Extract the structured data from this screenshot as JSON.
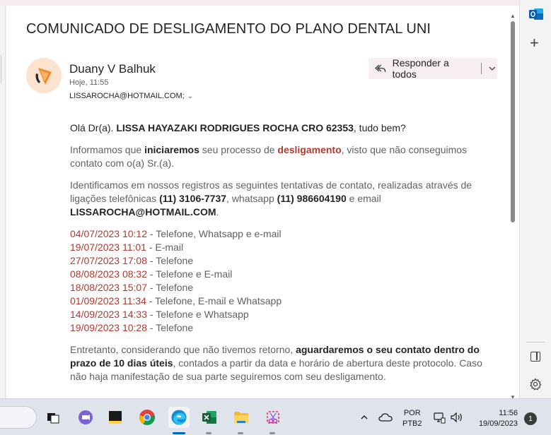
{
  "email": {
    "subject": "COMUNICADO DE DESLIGAMENTO DO PLANO DENTAL UNI",
    "sender_name": "Duany V Balhuk",
    "time": "Hoje, 11:55",
    "to": "LISSAROCHA@HOTMAIL.COM;",
    "reply_all_label": "Responder a todos",
    "greeting_prefix": "Olá Dr(a). ",
    "greeting_name": "LISSA HAYAZAKI RODRIGUES ROCHA CRO 62353",
    "greeting_suffix": ", tudo bem?",
    "p1_a": "Informamos que ",
    "p1_b": "iniciaremos",
    "p1_c": " seu processo de ",
    "p1_d": "desligamento",
    "p1_e": ", visto que não conseguimos contato com o(a) Sr.(a).",
    "p2_a": "Identificamos em nossos registros as seguintes tentativas de contato, realizadas através de ligações telefônicas ",
    "p2_phone": "(11) 3106-7737",
    "p2_b": ", whatsapp ",
    "p2_whats": "(11) 986604190",
    "p2_c": " e email ",
    "p2_email": "LISSAROCHA@HOTMAIL.COM",
    "p2_d": ".",
    "attempts": [
      {
        "date": "04/07/2023 10:12",
        "channel": " - Telefone, Whatsapp e e-mail"
      },
      {
        "date": "19/07/2023 11:01",
        "channel": " - E-mail"
      },
      {
        "date": "27/07/2023 17:08",
        "channel": " - Telefone"
      },
      {
        "date": "08/08/2023 08:32",
        "channel": " - Telefone e E-mail"
      },
      {
        "date": "18/08/2023 15:07",
        "channel": " - Telefone"
      },
      {
        "date": "01/09/2023 11:34",
        "channel": " - Telefone, E-mail e Whatsapp"
      },
      {
        "date": "14/09/2023 14:33",
        "channel": " - Telefone e Whatsapp"
      },
      {
        "date": "19/09/2023 10:28",
        "channel": " - Telefone"
      }
    ],
    "p3_a": "Entretanto, considerando que não tivemos retorno, ",
    "p3_b": "aguardaremos o seu contato dentro do prazo de 10 dias úteis",
    "p3_c": ", contados a partir da data e horário de abertura deste protocolo. Caso não haja manifestação de sua parte seguiremos com seu desligamento."
  },
  "taskbar": {
    "lang_top": "POR",
    "lang_bottom": "PTB2",
    "time": "11:56",
    "date": "19/09/2023",
    "notification_count": "1"
  },
  "colors": {
    "accent_red": "#b03a2e",
    "reply_bg": "#f7eef0",
    "outlook_blue": "#0f6cbd"
  }
}
